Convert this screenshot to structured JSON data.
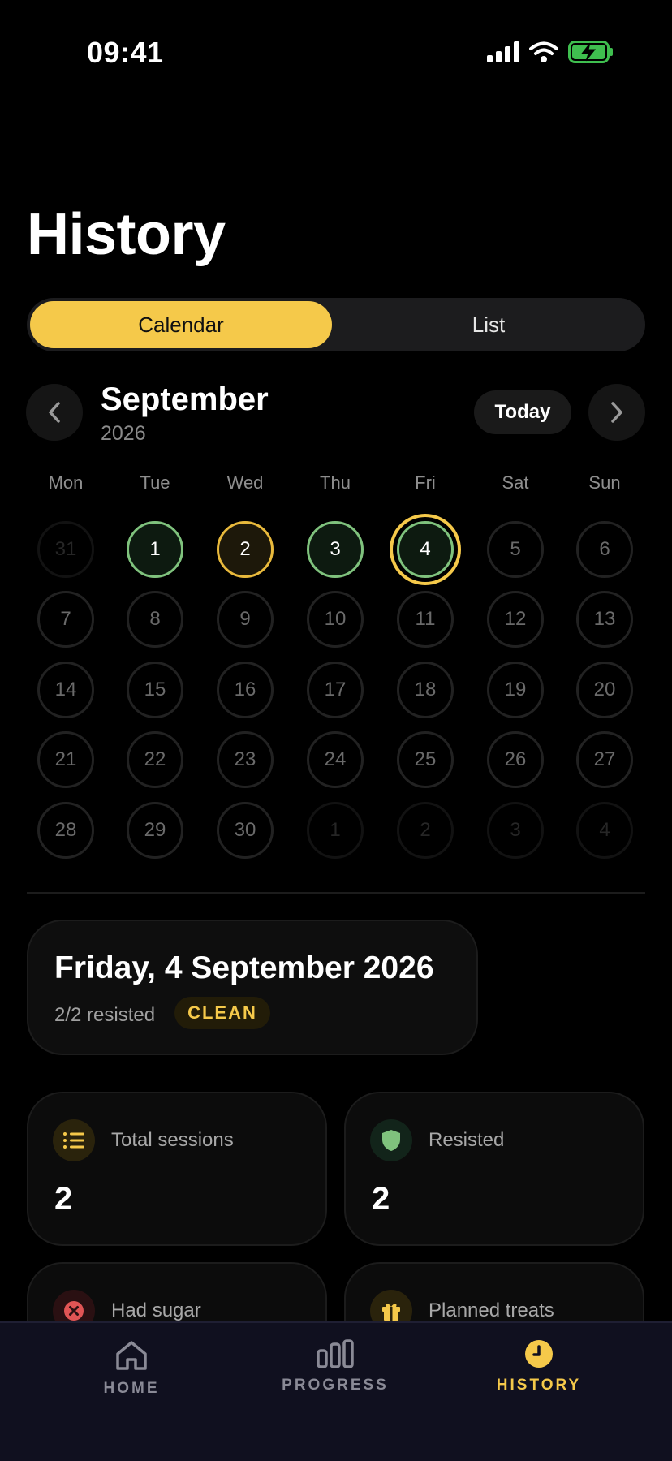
{
  "status_bar": {
    "time": "09:41"
  },
  "title": "History",
  "segmented": {
    "calendar": "Calendar",
    "list": "List"
  },
  "month_nav": {
    "month": "September",
    "year": "2026",
    "today": "Today"
  },
  "weekdays": [
    "Mon",
    "Tue",
    "Wed",
    "Thu",
    "Fri",
    "Sat",
    "Sun"
  ],
  "days": [
    {
      "label": "31",
      "state": "outside"
    },
    {
      "label": "1",
      "state": "green"
    },
    {
      "label": "2",
      "state": "yellow"
    },
    {
      "label": "3",
      "state": "green"
    },
    {
      "label": "4",
      "state": "selected"
    },
    {
      "label": "5",
      "state": "normal"
    },
    {
      "label": "6",
      "state": "normal"
    },
    {
      "label": "7",
      "state": "normal"
    },
    {
      "label": "8",
      "state": "normal"
    },
    {
      "label": "9",
      "state": "normal"
    },
    {
      "label": "10",
      "state": "normal"
    },
    {
      "label": "11",
      "state": "normal"
    },
    {
      "label": "12",
      "state": "normal"
    },
    {
      "label": "13",
      "state": "normal"
    },
    {
      "label": "14",
      "state": "normal"
    },
    {
      "label": "15",
      "state": "normal"
    },
    {
      "label": "16",
      "state": "normal"
    },
    {
      "label": "17",
      "state": "normal"
    },
    {
      "label": "18",
      "state": "normal"
    },
    {
      "label": "19",
      "state": "normal"
    },
    {
      "label": "20",
      "state": "normal"
    },
    {
      "label": "21",
      "state": "normal"
    },
    {
      "label": "22",
      "state": "normal"
    },
    {
      "label": "23",
      "state": "normal"
    },
    {
      "label": "24",
      "state": "normal"
    },
    {
      "label": "25",
      "state": "normal"
    },
    {
      "label": "26",
      "state": "normal"
    },
    {
      "label": "27",
      "state": "normal"
    },
    {
      "label": "28",
      "state": "normal"
    },
    {
      "label": "29",
      "state": "normal"
    },
    {
      "label": "30",
      "state": "normal"
    },
    {
      "label": "1",
      "state": "outside"
    },
    {
      "label": "2",
      "state": "outside"
    },
    {
      "label": "3",
      "state": "outside"
    },
    {
      "label": "4",
      "state": "outside"
    }
  ],
  "selected_day": {
    "title": "Friday, 4 September 2026",
    "summary": "2/2 resisted",
    "badge": "CLEAN"
  },
  "stats": {
    "total_sessions": {
      "label": "Total sessions",
      "value": "2",
      "icon": "list-icon"
    },
    "resisted": {
      "label": "Resisted",
      "value": "2",
      "icon": "shield-icon"
    },
    "had_sugar": {
      "label": "Had sugar",
      "icon": "x-circle-icon"
    },
    "planned_treats": {
      "label": "Planned treats",
      "icon": "gift-icon"
    }
  },
  "bottom_nav": {
    "home": "HOME",
    "progress": "PROGRESS",
    "history": "HISTORY",
    "active": "history"
  },
  "colors": {
    "accent": "#f5c94a",
    "success": "#7fc27d",
    "danger": "#e05555",
    "background": "#000000"
  }
}
